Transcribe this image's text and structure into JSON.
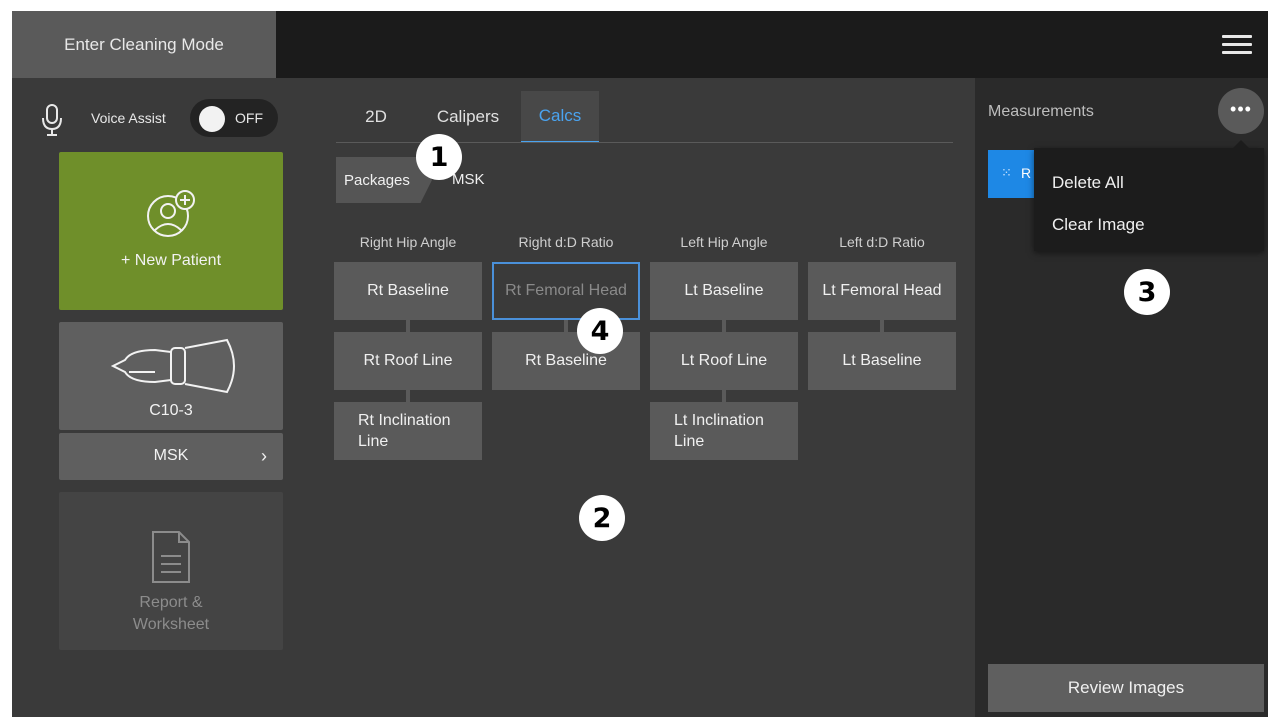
{
  "topbar": {
    "cleaning_label": "Enter Cleaning Mode",
    "menu_icon": "hamburger-menu-icon"
  },
  "left": {
    "voice_label": "Voice Assist",
    "voice_state": "OFF",
    "new_patient_label": "+ New Patient",
    "probe_label": "C10-3",
    "preset_label": "MSK",
    "preset_chevron": "›",
    "report_label_line1": "Report &",
    "report_label_line2": "Worksheet"
  },
  "center": {
    "tabs": [
      {
        "label": "2D"
      },
      {
        "label": "Calipers"
      },
      {
        "label": "Calcs",
        "active": true
      }
    ],
    "breadcrumb": {
      "packages": "Packages",
      "current": "MSK"
    },
    "columns": [
      {
        "heading": "Right Hip Angle",
        "buttons": [
          "Rt Baseline",
          "Rt Roof Line",
          "Rt Inclination Line"
        ]
      },
      {
        "heading": "Right d:D Ratio",
        "buttons": [
          "Rt Femoral Head",
          "Rt Baseline"
        ]
      },
      {
        "heading": "Left Hip Angle",
        "buttons": [
          "Lt Baseline",
          "Lt Roof Line",
          "Lt Inclination Line"
        ]
      },
      {
        "heading": "Left d:D Ratio",
        "buttons": [
          "Lt Femoral Head",
          "Lt Baseline"
        ]
      }
    ],
    "active_button": "Rt Femoral Head"
  },
  "right": {
    "title": "Measurements",
    "more_label": "•••",
    "item_icon": "x-caliper-icon",
    "item_label": "R",
    "menu": [
      "Delete All",
      "Clear Image"
    ],
    "review_label": "Review Images"
  },
  "callouts": [
    "1",
    "2",
    "3",
    "4"
  ],
  "colors": {
    "accent_blue": "#4aa3ef",
    "new_patient_green": "#6f8f2a",
    "measurement_blue": "#1e88e5"
  }
}
